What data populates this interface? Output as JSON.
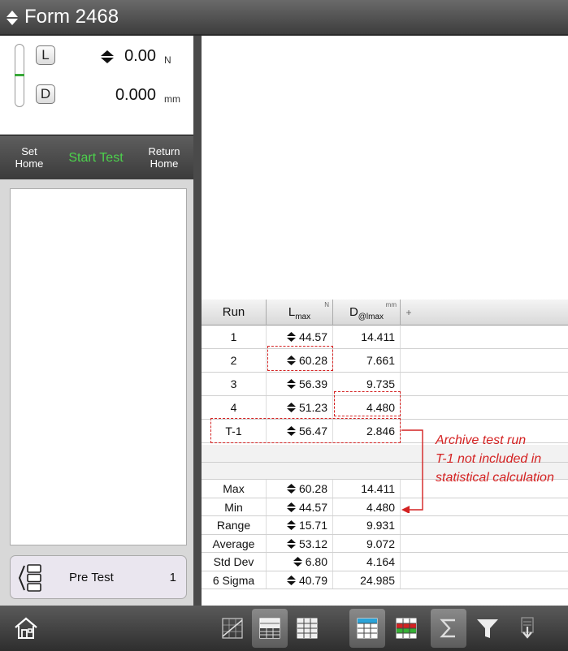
{
  "title": "Form 2468",
  "readout": {
    "load_key": "L",
    "load_value": "0.00",
    "load_unit": "N",
    "disp_key": "D",
    "disp_value": "0.000",
    "disp_unit": "mm"
  },
  "controls": {
    "set_home": "Set\nHome",
    "start_test": "Start Test",
    "return_home": "Return\nHome"
  },
  "pretest": {
    "label": "Pre Test",
    "count": "1"
  },
  "table": {
    "headers": {
      "run": "Run",
      "lmax": "L",
      "lmax_sub": "max",
      "lmax_unit": "N",
      "d": "D",
      "d_sub": "@lmax",
      "d_unit": "mm",
      "add": "+"
    },
    "rows": [
      {
        "run": "1",
        "lmax": "44.57",
        "d": "14.411"
      },
      {
        "run": "2",
        "lmax": "60.28",
        "d": "7.661"
      },
      {
        "run": "3",
        "lmax": "56.39",
        "d": "9.735"
      },
      {
        "run": "4",
        "lmax": "51.23",
        "d": "4.480"
      },
      {
        "run": "T-1",
        "lmax": "56.47",
        "d": "2.846"
      }
    ],
    "stats": [
      {
        "label": "Max",
        "lmax": "60.28",
        "d": "14.411"
      },
      {
        "label": "Min",
        "lmax": "44.57",
        "d": "4.480"
      },
      {
        "label": "Range",
        "lmax": "15.71",
        "d": "9.931"
      },
      {
        "label": "Average",
        "lmax": "53.12",
        "d": "9.072"
      },
      {
        "label": "Std Dev",
        "lmax": "6.80",
        "d": "4.164"
      },
      {
        "label": "6 Sigma",
        "lmax": "40.79",
        "d": "24.985"
      }
    ]
  },
  "annotation": {
    "line1": "Archive test run",
    "line2": "T-1 not included in",
    "line3": "statistical calculation"
  },
  "colors": {
    "accent_green": "#4cd24c",
    "annotation_red": "#d42222"
  },
  "toolbar_icons": [
    "home-icon",
    "graph-view-icon",
    "graph-table-view-icon",
    "table-view-icon",
    "table-blue-icon",
    "table-red-green-icon",
    "sigma-icon",
    "funnel-icon",
    "export-icon"
  ]
}
